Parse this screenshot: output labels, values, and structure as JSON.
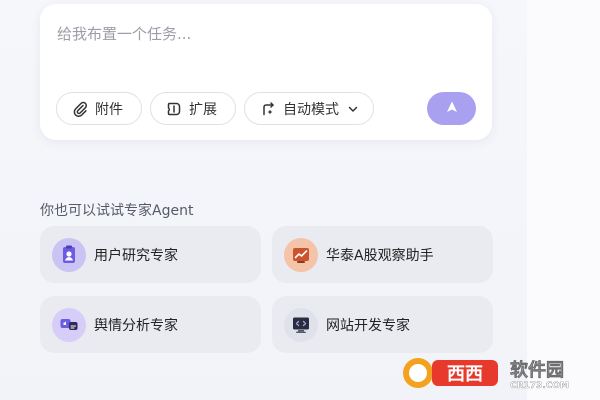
{
  "task_input": {
    "placeholder": "给我布置一个任务...",
    "value": ""
  },
  "toolbar": {
    "attach_label": "附件",
    "extend_label": "扩展",
    "mode_label": "自动模式"
  },
  "agents": {
    "section_title": "你也可以试试专家Agent",
    "items": [
      {
        "label": "用户研究专家",
        "icon": "user-research-icon"
      },
      {
        "label": "华泰A股观察助手",
        "icon": "stock-chart-icon"
      },
      {
        "label": "舆情分析专家",
        "icon": "sentiment-icon"
      },
      {
        "label": "网站开发专家",
        "icon": "monitor-code-icon"
      }
    ]
  },
  "watermark": {
    "brand": "西西",
    "suffix": "软件园",
    "domain": "CR173.COM"
  },
  "colors": {
    "accent": "#a9a0f0",
    "card_bg": "#e9ebf1"
  }
}
